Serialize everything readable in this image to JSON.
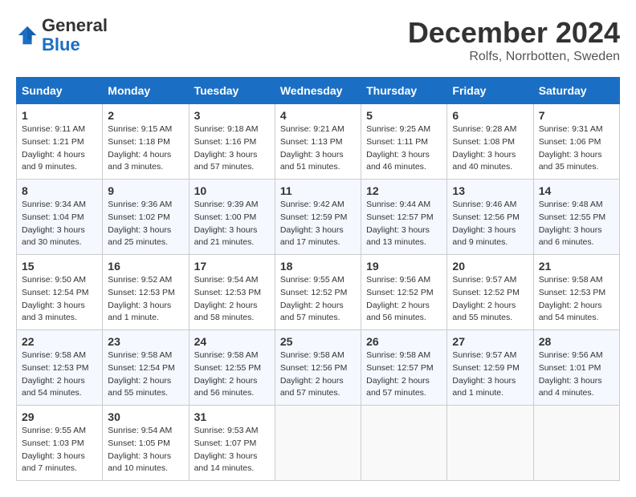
{
  "header": {
    "logo_general": "General",
    "logo_blue": "Blue",
    "title": "December 2024",
    "subtitle": "Rolfs, Norrbotten, Sweden"
  },
  "days_of_week": [
    "Sunday",
    "Monday",
    "Tuesday",
    "Wednesday",
    "Thursday",
    "Friday",
    "Saturday"
  ],
  "weeks": [
    [
      {
        "day": "1",
        "sunrise": "9:11 AM",
        "sunset": "1:21 PM",
        "daylight": "4 hours and 9 minutes."
      },
      {
        "day": "2",
        "sunrise": "9:15 AM",
        "sunset": "1:18 PM",
        "daylight": "4 hours and 3 minutes."
      },
      {
        "day": "3",
        "sunrise": "9:18 AM",
        "sunset": "1:16 PM",
        "daylight": "3 hours and 57 minutes."
      },
      {
        "day": "4",
        "sunrise": "9:21 AM",
        "sunset": "1:13 PM",
        "daylight": "3 hours and 51 minutes."
      },
      {
        "day": "5",
        "sunrise": "9:25 AM",
        "sunset": "1:11 PM",
        "daylight": "3 hours and 46 minutes."
      },
      {
        "day": "6",
        "sunrise": "9:28 AM",
        "sunset": "1:08 PM",
        "daylight": "3 hours and 40 minutes."
      },
      {
        "day": "7",
        "sunrise": "9:31 AM",
        "sunset": "1:06 PM",
        "daylight": "3 hours and 35 minutes."
      }
    ],
    [
      {
        "day": "8",
        "sunrise": "9:34 AM",
        "sunset": "1:04 PM",
        "daylight": "3 hours and 30 minutes."
      },
      {
        "day": "9",
        "sunrise": "9:36 AM",
        "sunset": "1:02 PM",
        "daylight": "3 hours and 25 minutes."
      },
      {
        "day": "10",
        "sunrise": "9:39 AM",
        "sunset": "1:00 PM",
        "daylight": "3 hours and 21 minutes."
      },
      {
        "day": "11",
        "sunrise": "9:42 AM",
        "sunset": "12:59 PM",
        "daylight": "3 hours and 17 minutes."
      },
      {
        "day": "12",
        "sunrise": "9:44 AM",
        "sunset": "12:57 PM",
        "daylight": "3 hours and 13 minutes."
      },
      {
        "day": "13",
        "sunrise": "9:46 AM",
        "sunset": "12:56 PM",
        "daylight": "3 hours and 9 minutes."
      },
      {
        "day": "14",
        "sunrise": "9:48 AM",
        "sunset": "12:55 PM",
        "daylight": "3 hours and 6 minutes."
      }
    ],
    [
      {
        "day": "15",
        "sunrise": "9:50 AM",
        "sunset": "12:54 PM",
        "daylight": "3 hours and 3 minutes."
      },
      {
        "day": "16",
        "sunrise": "9:52 AM",
        "sunset": "12:53 PM",
        "daylight": "3 hours and 1 minute."
      },
      {
        "day": "17",
        "sunrise": "9:54 AM",
        "sunset": "12:53 PM",
        "daylight": "2 hours and 58 minutes."
      },
      {
        "day": "18",
        "sunrise": "9:55 AM",
        "sunset": "12:52 PM",
        "daylight": "2 hours and 57 minutes."
      },
      {
        "day": "19",
        "sunrise": "9:56 AM",
        "sunset": "12:52 PM",
        "daylight": "2 hours and 56 minutes."
      },
      {
        "day": "20",
        "sunrise": "9:57 AM",
        "sunset": "12:52 PM",
        "daylight": "2 hours and 55 minutes."
      },
      {
        "day": "21",
        "sunrise": "9:58 AM",
        "sunset": "12:53 PM",
        "daylight": "2 hours and 54 minutes."
      }
    ],
    [
      {
        "day": "22",
        "sunrise": "9:58 AM",
        "sunset": "12:53 PM",
        "daylight": "2 hours and 54 minutes."
      },
      {
        "day": "23",
        "sunrise": "9:58 AM",
        "sunset": "12:54 PM",
        "daylight": "2 hours and 55 minutes."
      },
      {
        "day": "24",
        "sunrise": "9:58 AM",
        "sunset": "12:55 PM",
        "daylight": "2 hours and 56 minutes."
      },
      {
        "day": "25",
        "sunrise": "9:58 AM",
        "sunset": "12:56 PM",
        "daylight": "2 hours and 57 minutes."
      },
      {
        "day": "26",
        "sunrise": "9:58 AM",
        "sunset": "12:57 PM",
        "daylight": "2 hours and 57 minutes."
      },
      {
        "day": "27",
        "sunrise": "9:57 AM",
        "sunset": "12:59 PM",
        "daylight": "3 hours and 1 minute."
      },
      {
        "day": "28",
        "sunrise": "9:56 AM",
        "sunset": "1:01 PM",
        "daylight": "3 hours and 4 minutes."
      }
    ],
    [
      {
        "day": "29",
        "sunrise": "9:55 AM",
        "sunset": "1:03 PM",
        "daylight": "3 hours and 7 minutes."
      },
      {
        "day": "30",
        "sunrise": "9:54 AM",
        "sunset": "1:05 PM",
        "daylight": "3 hours and 10 minutes."
      },
      {
        "day": "31",
        "sunrise": "9:53 AM",
        "sunset": "1:07 PM",
        "daylight": "3 hours and 14 minutes."
      },
      null,
      null,
      null,
      null
    ]
  ]
}
